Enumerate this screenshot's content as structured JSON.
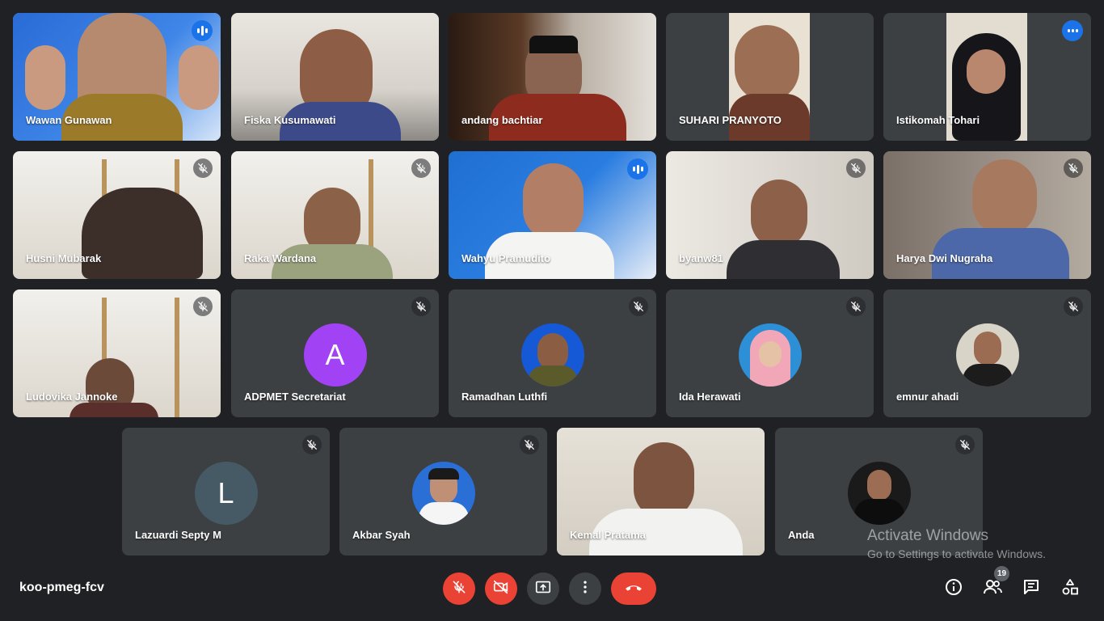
{
  "participants": [
    {
      "name": "Wawan Gunawan",
      "speaking": true
    },
    {
      "name": "Fiska Kusumawati"
    },
    {
      "name": "andang bachtiar"
    },
    {
      "name": "SUHARI PRANYOTO"
    },
    {
      "name": "Istikomah Tohari"
    },
    {
      "name": "Husni Mubarak"
    },
    {
      "name": "Raka Wardana"
    },
    {
      "name": "Wahyu Pramudito"
    },
    {
      "name": "byanw81"
    },
    {
      "name": "Harya Dwi Nugraha"
    },
    {
      "name": "Ludovika Jannoke"
    },
    {
      "name": "ADPMET Secretariat",
      "initial": "A"
    },
    {
      "name": "Ramadhan Luthfi"
    },
    {
      "name": "Ida Herawati"
    },
    {
      "name": "emnur ahadi"
    },
    {
      "name": "Lazuardi Septy M",
      "initial": "L"
    },
    {
      "name": "Akbar Syah"
    },
    {
      "name": "Kemal Pratama"
    },
    {
      "name": "Anda"
    }
  ],
  "meeting_code": "koo-pmeg-fcv",
  "participant_count": "19",
  "watermark": {
    "line1": "Activate Windows",
    "line2": "Go to Settings to activate Windows."
  },
  "colors": {
    "accent": "#8ab4f8",
    "red": "#ea4335",
    "tile": "#3c4043",
    "background": "#202124",
    "avatar_a": "#a142f4",
    "avatar_l": "#455a64"
  },
  "icons": {
    "mic_off": "mic-off-icon",
    "camera_off": "camera-off-icon",
    "present": "present-screen-icon",
    "more": "more-vert-icon",
    "leave": "call-end-icon",
    "info": "info-icon",
    "people": "people-icon",
    "chat": "chat-icon",
    "activities": "activities-icon"
  }
}
